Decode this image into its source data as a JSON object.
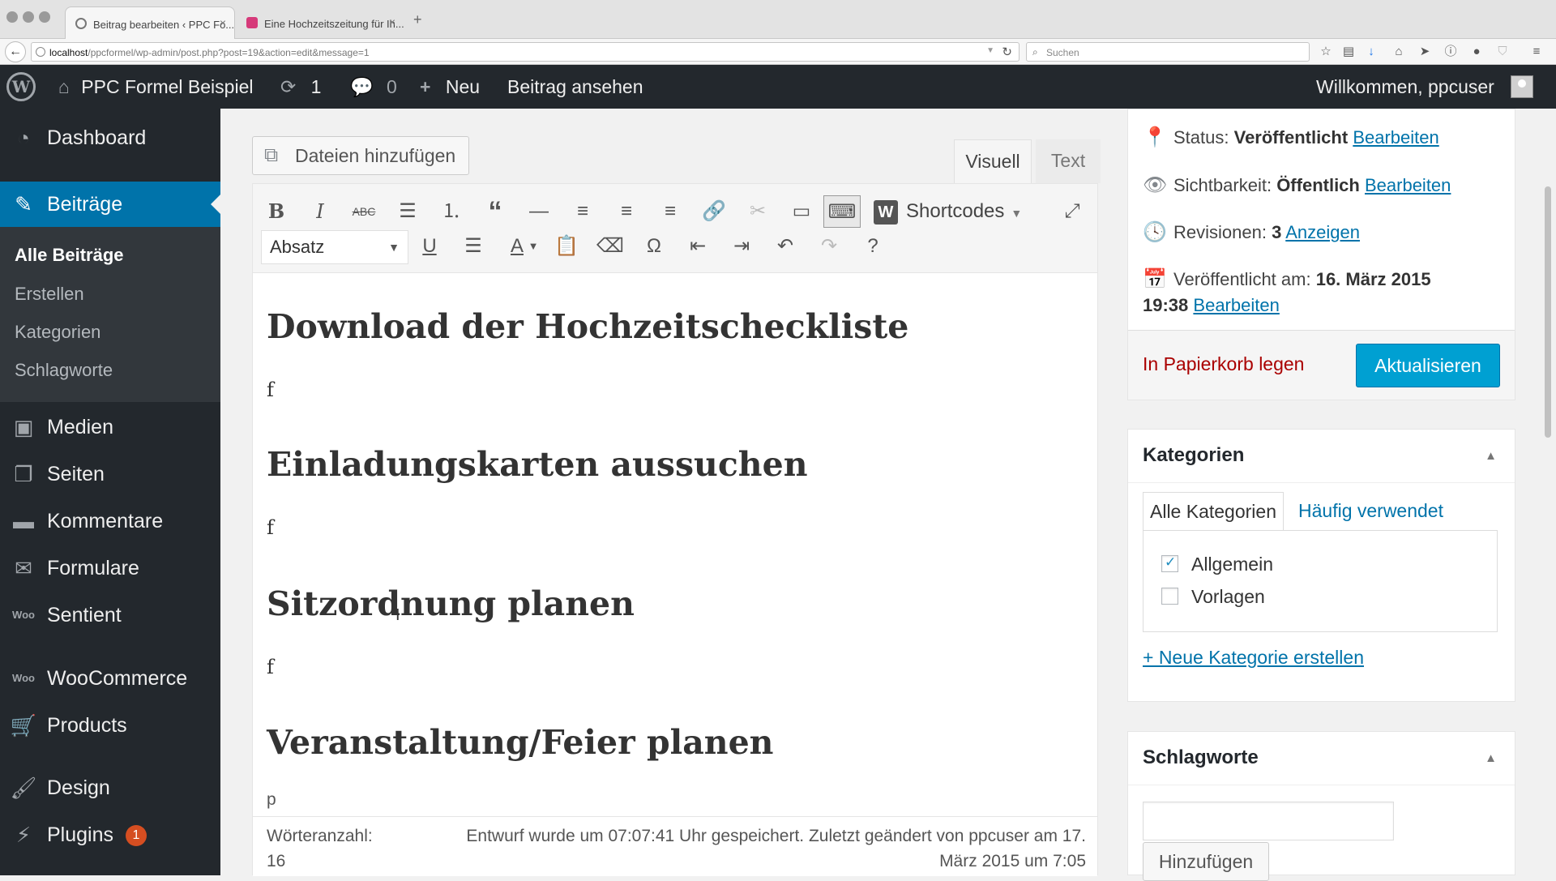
{
  "browser": {
    "tabs": [
      {
        "title": "Beitrag bearbeiten ‹ PPC Fo...",
        "active": true
      },
      {
        "title": "Eine Hochzeitszeitung für Ih...",
        "active": false
      }
    ],
    "url_host": "localhost",
    "url_path": "/ppcformel/wp-admin/post.php?post=19&action=edit&message=1",
    "search_placeholder": "Suchen"
  },
  "admin_bar": {
    "site_name": "PPC Formel Beispiel",
    "updates_count": "1",
    "comments_count": "0",
    "new_label": "Neu",
    "view_post_label": "Beitrag ansehen",
    "welcome": "Willkommen, ppcuser"
  },
  "sidebar": {
    "dashboard": "Dashboard",
    "posts": "Beiträge",
    "posts_sub": [
      "Alle Beiträge",
      "Erstellen",
      "Kategorien",
      "Schlagworte"
    ],
    "media": "Medien",
    "pages": "Seiten",
    "comments": "Kommentare",
    "forms": "Formulare",
    "sentient": "Sentient",
    "woocommerce": "WooCommerce",
    "products": "Products",
    "design": "Design",
    "plugins": "Plugins",
    "plugins_badge": "1"
  },
  "editor": {
    "add_media": "Dateien hinzufügen",
    "tab_visual": "Visuell",
    "tab_text": "Text",
    "format_select": "Absatz",
    "shortcodes": "Shortcodes",
    "content": [
      {
        "type": "h",
        "text": "Download der Hochzeitscheckliste"
      },
      {
        "type": "p",
        "text": "f"
      },
      {
        "type": "h",
        "text": "Einladungskarten aussuchen"
      },
      {
        "type": "p",
        "text": "f"
      },
      {
        "type": "h",
        "text": "Sitzordnung planen"
      },
      {
        "type": "p",
        "text": "f"
      },
      {
        "type": "h",
        "text": "Veranstaltung/Feier planen"
      }
    ],
    "path_indicator": "p",
    "word_count_label": "Wörteranzahl:",
    "word_count": "16",
    "autosave_line1": "Entwurf wurde um 07:07:41 Uhr gespeichert. Zuletzt geändert von ppcuser am 17.",
    "autosave_line2": "März 2015 um 7:05"
  },
  "publish_box": {
    "status_label": "Status:",
    "status_value": "Veröffentlicht",
    "visibility_label": "Sichtbarkeit:",
    "visibility_value": "Öffentlich",
    "revisions_label": "Revisionen:",
    "revisions_value": "3",
    "revisions_link": "Anzeigen",
    "published_label": "Veröffentlicht am:",
    "published_date": "16. März 2015",
    "published_time": "19:38",
    "edit_link": "Bearbeiten",
    "trash": "In Papierkorb legen",
    "update_button": "Aktualisieren"
  },
  "categories_box": {
    "title": "Kategorien",
    "tab_all": "Alle Kategorien",
    "tab_popular": "Häufig verwendet",
    "items": [
      {
        "label": "Allgemein",
        "checked": true
      },
      {
        "label": "Vorlagen",
        "checked": false
      }
    ],
    "new_category": "+ Neue Kategorie erstellen"
  },
  "tags_box": {
    "title": "Schlagworte",
    "add_button": "Hinzufügen"
  },
  "colors": {
    "admin_bg": "#23282d",
    "accent": "#0073aa",
    "primary_button": "#00a0d2",
    "trash_red": "#aa0000"
  }
}
